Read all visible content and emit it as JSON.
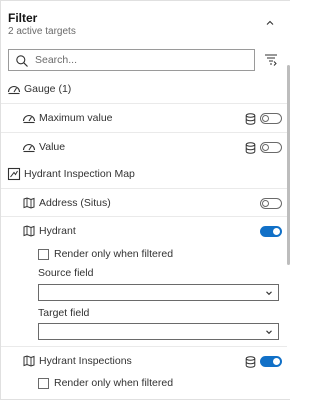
{
  "header": {
    "title": "Filter",
    "subtitle": "2 active targets"
  },
  "search": {
    "placeholder": "Search...",
    "value": ""
  },
  "groups": {
    "gauge": {
      "label": "Gauge (1)",
      "items": {
        "max_value": {
          "label": "Maximum value",
          "enabled": false
        },
        "value": {
          "label": "Value",
          "enabled": false
        }
      }
    },
    "map": {
      "label": "Hydrant Inspection Map",
      "items": {
        "address": {
          "label": "Address (Situs)",
          "enabled": false
        },
        "hydrant": {
          "label": "Hydrant",
          "enabled": true,
          "render_only_label": "Render only when filtered",
          "source_field_label": "Source field",
          "source_field_value": "",
          "target_field_label": "Target field",
          "target_field_value": ""
        },
        "inspections": {
          "label": "Hydrant Inspections",
          "enabled": true,
          "render_only_label": "Render only when filtered"
        }
      }
    }
  },
  "colors": {
    "accent": "#1170c7",
    "text": "#323232",
    "muted": "#6a6a6a"
  }
}
